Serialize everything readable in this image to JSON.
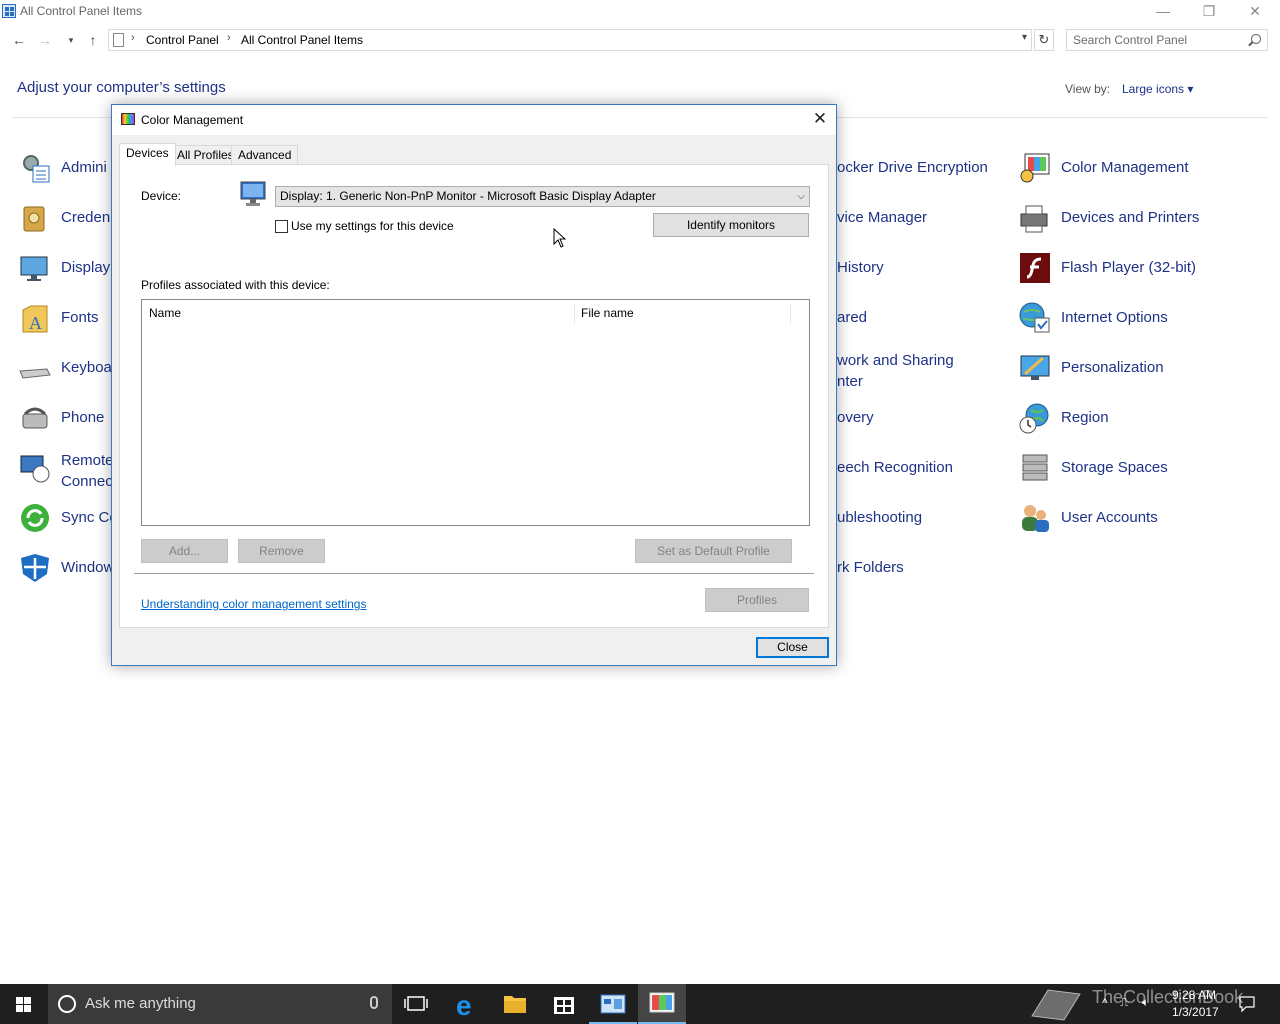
{
  "window": {
    "title": "All Control Panel Items",
    "minimize": "—",
    "restore": "❐",
    "close": "✕"
  },
  "address": {
    "crumbs": [
      "Control Panel",
      "All Control Panel Items"
    ],
    "search_placeholder": "Search Control Panel"
  },
  "content": {
    "heading": "Adjust your computer’s settings",
    "view_by_label": "View by:",
    "view_by_value": "Large icons"
  },
  "items": {
    "col1": [
      {
        "label": "Admini",
        "icon": "administrative-tools-icon"
      },
      {
        "label": "Creden",
        "icon": "credential-manager-icon"
      },
      {
        "label": "Display",
        "icon": "display-icon"
      },
      {
        "label": "Fonts",
        "icon": "fonts-icon"
      },
      {
        "label": "Keyboa",
        "icon": "keyboard-icon"
      },
      {
        "label": "Phone",
        "icon": "phone-and-modem-icon"
      },
      {
        "label": "Remote\nConnec",
        "icon": "remoteapp-icon"
      },
      {
        "label": "Sync Ce",
        "icon": "sync-center-icon"
      },
      {
        "label": "Window",
        "icon": "windows-defender-icon"
      }
    ],
    "col2": [
      "ocker Drive Encryption",
      "vice Manager",
      "History",
      "ared",
      "work and Sharing\nnter",
      "overy",
      "eech Recognition",
      "ubleshooting",
      "rk Folders"
    ],
    "col3": [
      {
        "label": "Color Management",
        "icon": "color-management-icon"
      },
      {
        "label": "Devices and Printers",
        "icon": "devices-and-printers-icon"
      },
      {
        "label": "Flash Player (32-bit)",
        "icon": "flash-player-icon"
      },
      {
        "label": "Internet Options",
        "icon": "internet-options-icon"
      },
      {
        "label": "Personalization",
        "icon": "personalization-icon"
      },
      {
        "label": "Region",
        "icon": "region-icon"
      },
      {
        "label": "Storage Spaces",
        "icon": "storage-spaces-icon"
      },
      {
        "label": "User Accounts",
        "icon": "user-accounts-icon"
      }
    ]
  },
  "dialog": {
    "title": "Color Management",
    "close_glyph": "✕",
    "tabs": [
      "Devices",
      "All Profiles",
      "Advanced"
    ],
    "device_label": "Device:",
    "device_value": "Display: 1. Generic Non-PnP Monitor - Microsoft Basic Display Adapter",
    "use_my_settings": "Use my settings for this device",
    "identify_monitors": "Identify monitors",
    "profiles_label": "Profiles associated with this device:",
    "columns": [
      "Name",
      "File name"
    ],
    "add_button": "Add...",
    "remove_button": "Remove",
    "set_default_button": "Set as Default Profile",
    "link": "Understanding color management settings",
    "profiles_button": "Profiles",
    "close_button": "Close"
  },
  "taskbar": {
    "search_text": "Ask me anything",
    "time": "9:28 AM",
    "date": "1/3/2017",
    "watermark": "TheCollectionBook"
  },
  "colors": {
    "link_blue": "#1e3287",
    "taskbar": "#1f1f1f",
    "accent": "#0078d7"
  }
}
